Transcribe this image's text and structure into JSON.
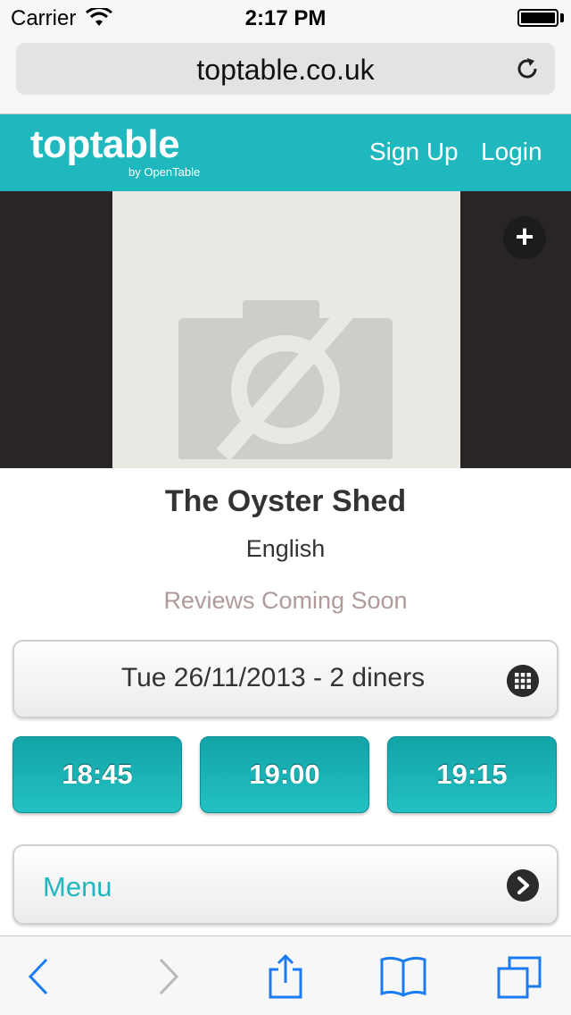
{
  "status_bar": {
    "carrier": "Carrier",
    "time": "2:17 PM"
  },
  "browser": {
    "url": "toptable.co.uk"
  },
  "header": {
    "logo_main": "toptable",
    "logo_sub": "by OpenTable",
    "nav": {
      "signup": "Sign Up",
      "login": "Login"
    }
  },
  "photo": {
    "add_label": "+"
  },
  "restaurant": {
    "name": "The Oyster Shed",
    "cuisine": "English",
    "reviews": "Reviews Coming Soon"
  },
  "booking": {
    "date_summary": "Tue 26/11/2013 - 2 diners",
    "times": [
      "18:45",
      "19:00",
      "19:15"
    ]
  },
  "menu": {
    "label": "Menu"
  },
  "colors": {
    "brand": "#1eb8be",
    "ios_blue": "#1a7cf3"
  },
  "icons": [
    "wifi-icon",
    "battery-icon",
    "reload-icon",
    "camera-placeholder-icon",
    "add-photo-icon",
    "calendar-grid-icon",
    "chevron-right-icon",
    "back-icon",
    "forward-icon",
    "share-icon",
    "bookmarks-icon",
    "tabs-icon"
  ]
}
